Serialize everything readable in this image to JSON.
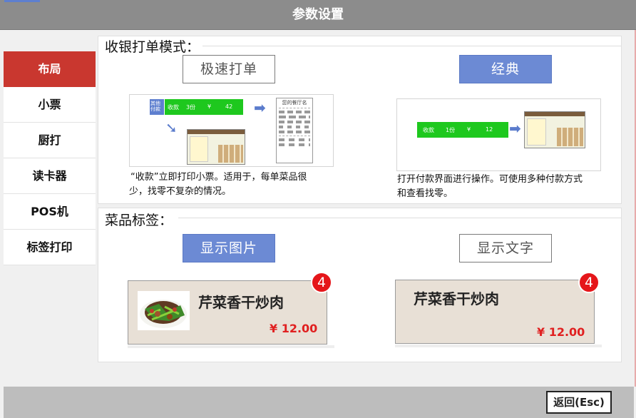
{
  "window": {
    "title": "参数设置"
  },
  "sidebar": {
    "items": [
      {
        "label": "布局",
        "active": true
      },
      {
        "label": "小票",
        "active": false
      },
      {
        "label": "厨打",
        "active": false
      },
      {
        "label": "读卡器",
        "active": false
      },
      {
        "label": "POS机",
        "active": false
      },
      {
        "label": "标签打印",
        "active": false
      }
    ]
  },
  "checkout_mode": {
    "title": "收银打单模式：",
    "fast": {
      "label": "极速打单",
      "selected": false,
      "description_line1": "“收款”立即打印小票。适用于，每单菜品很",
      "description_line2": "少，找零不复杂的情况。",
      "preview": {
        "bar_left": "其他\n付款",
        "bar_text": "收款",
        "bar_count": "3份",
        "bar_currency": "¥",
        "bar_amount": "42",
        "receipt_title": "您的餐厅名"
      }
    },
    "classic": {
      "label": "经典",
      "selected": true,
      "description_line1": "打开付款界面进行操作。可使用多种付款方式",
      "description_line2": "和查看找零。",
      "preview": {
        "bar_text": "收款",
        "bar_count": "1份",
        "bar_currency": "¥",
        "bar_amount": "12"
      }
    }
  },
  "dish_label": {
    "title": "菜品标签：",
    "show_image": {
      "label": "显示图片",
      "selected": true
    },
    "show_text": {
      "label": "显示文字",
      "selected": false
    },
    "card_image": {
      "name": "芹菜香干炒肉",
      "price": "¥ 12.00",
      "badge": "4"
    },
    "card_text": {
      "name": "芹菜香干炒肉",
      "price": "¥ 12.00",
      "badge": "4"
    }
  },
  "footer": {
    "back_label": "返回(Esc)"
  },
  "colors": {
    "accent_red": "#c9372f",
    "selected_blue": "#6c8ad4",
    "price_red": "#e02020",
    "badge_red": "#e5161a"
  }
}
